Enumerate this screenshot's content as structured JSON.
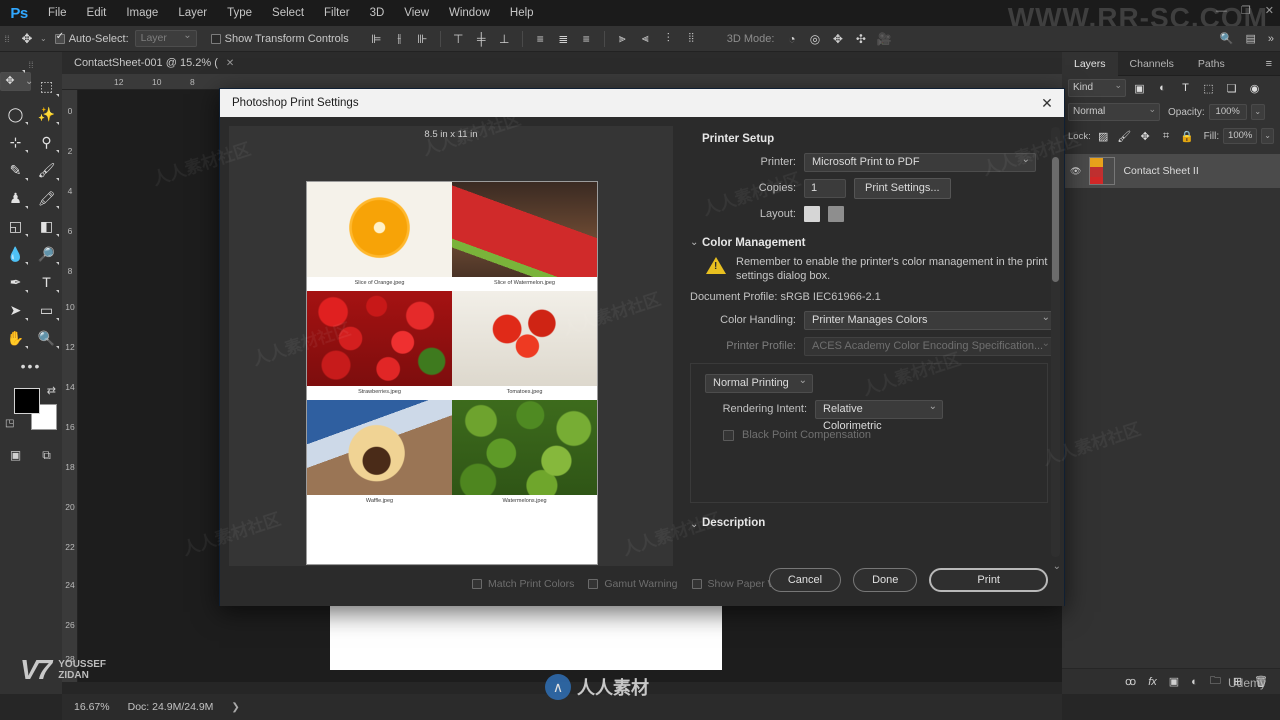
{
  "app": {
    "logo": "Ps",
    "menus": [
      "File",
      "Edit",
      "Image",
      "Layer",
      "Type",
      "Select",
      "Filter",
      "3D",
      "View",
      "Window",
      "Help"
    ],
    "watermark_top": "WWW.RR-SC.COM",
    "watermark_center": "人人素材",
    "watermark_brand_v7": "V7",
    "watermark_brand_line1": "YOUSSEF",
    "watermark_brand_line2": "ZIDAN",
    "watermark_udemy": "Udemy",
    "win_minimize": "—",
    "win_restore": "❐",
    "win_close": "✕"
  },
  "options_bar": {
    "tool_icon": "move-tool",
    "auto_select_label": "Auto-Select:",
    "auto_select_checked": true,
    "layer_select_value": "Layer",
    "show_transform_label": "Show Transform Controls",
    "show_transform_checked": false,
    "align_icons": [
      "align-left-edges",
      "align-horizontal-centers",
      "align-right-edges",
      "align-top-edges",
      "align-vertical-centers",
      "align-bottom-edges"
    ],
    "distribute_icons": [
      "distribute-top-edges",
      "distribute-vertical-centers",
      "distribute-bottom-edges",
      "distribute-left-edges",
      "distribute-horizontal-centers",
      "distribute-right-edges",
      "distribute-spacing"
    ],
    "three_d_label": "3D Mode:",
    "three_d_icons": [
      "orbit-3d",
      "roll-3d",
      "pan-3d",
      "slide-3d",
      "camera-3d"
    ],
    "search_icon": "search-icon",
    "arrange_icon": "arrange-documents-icon"
  },
  "toolbox": {
    "tools": [
      "move-tool",
      "rectangular-marquee-tool",
      "lasso-tool",
      "magic-wand-tool",
      "crop-tool",
      "eyedropper-tool",
      "healing-brush-tool",
      "brush-tool",
      "clone-stamp-tool",
      "history-brush-tool",
      "eraser-tool",
      "gradient-tool",
      "blur-tool",
      "dodge-tool",
      "pen-tool",
      "type-tool",
      "path-selection-tool",
      "rectangle-tool",
      "hand-tool",
      "zoom-tool"
    ],
    "more_tools": "•••",
    "foreground_color": "#000000",
    "background_color": "#ffffff",
    "swap_colors_icon": "swap-colors-icon",
    "default_colors_icon": "default-colors-icon",
    "quick_mask_icon": "quick-mask-icon",
    "screen_mode_icon": "screen-mode-icon"
  },
  "document": {
    "tab_title": "ContactSheet-001 @ 15.2% (",
    "tab_close": "✕",
    "ruler_h_ticks": [
      "12",
      "10",
      "8"
    ],
    "ruler_v_ticks": [
      "0",
      "2",
      "4",
      "6",
      "8",
      "10",
      "12",
      "14",
      "16",
      "18",
      "20",
      "22",
      "24",
      "26",
      "28"
    ]
  },
  "status_bar": {
    "zoom": "16.67%",
    "doc_info": "Doc: 24.9M/24.9M",
    "expand_arrow": "❯"
  },
  "layers_panel": {
    "tabs": [
      "Layers",
      "Channels",
      "Paths"
    ],
    "active_tab": "Layers",
    "menu_icon": "panel-menu-icon",
    "blend_mode": "Normal",
    "opacity_label": "Opacity:",
    "opacity_value": "100%",
    "fill_label": "Fill:",
    "fill_value": "100%",
    "filter_icons": [
      "filter-image-icon",
      "filter-adjustment-icon",
      "filter-type-icon",
      "filter-shape-icon",
      "filter-smart-object-icon",
      "filter-toggle-icon"
    ],
    "lock_icons": [
      "lock-transparent-icon",
      "lock-image-icon",
      "lock-position-icon",
      "lock-artboard-icon",
      "lock-all-icon"
    ],
    "layer_name": "Contact Sheet II",
    "footer_icons": [
      "link-layers-icon",
      "layer-style-icon",
      "layer-mask-icon",
      "adjustment-layer-icon",
      "new-group-icon",
      "new-layer-icon",
      "delete-layer-icon"
    ]
  },
  "dialog": {
    "title": "Photoshop Print Settings",
    "close_icon": "close-icon",
    "paper_size_label": "8.5 in x 11 in",
    "printer_setup": {
      "section_title": "Printer Setup",
      "twirl": "⌄",
      "printer_label": "Printer:",
      "printer_value": "Microsoft Print to PDF",
      "copies_label": "Copies:",
      "copies_value": "1",
      "print_settings_button": "Print Settings...",
      "layout_label": "Layout:",
      "layout_portrait_icon": "layout-portrait-icon",
      "layout_landscape_icon": "layout-landscape-icon"
    },
    "color_management": {
      "section_title": "Color Management",
      "twirl": "⌄",
      "warning_icon": "warning-triangle-icon",
      "warning_text": "Remember to enable the printer's color management in the print settings dialog box.",
      "document_profile_label": "Document Profile:",
      "document_profile_value": "sRGB IEC61966-2.1",
      "color_handling_label": "Color Handling:",
      "color_handling_value": "Printer Manages Colors",
      "printer_profile_label": "Printer Profile:",
      "printer_profile_value": "ACES Academy Color Encoding Specification...",
      "printing_mode_value": "Normal Printing",
      "rendering_intent_label": "Rendering Intent:",
      "rendering_intent_value": "Relative Colorimetric",
      "black_point_label": "Black Point Compensation",
      "black_point_checked": false
    },
    "description": {
      "section_title": "Description",
      "twirl": "⌄"
    },
    "bottom_checks": [
      {
        "label": "Match Print Colors",
        "checked": false
      },
      {
        "label": "Gamut Warning",
        "checked": false
      },
      {
        "label": "Show Paper White",
        "checked": false
      }
    ],
    "buttons": {
      "cancel": "Cancel",
      "done": "Done",
      "print": "Print"
    }
  },
  "contact_sheet": {
    "cells": [
      {
        "caption": "Slice of Orange.jpeg",
        "kind": "orange"
      },
      {
        "caption": "Slice of Watermelon.jpeg",
        "kind": "watermelon"
      },
      {
        "caption": "Strawberries.jpeg",
        "kind": "strawberries"
      },
      {
        "caption": "Tomatoes.jpeg",
        "kind": "tomatoes"
      },
      {
        "caption": "Waffle.jpeg",
        "kind": "waffle"
      },
      {
        "caption": "Watermelons.jpeg",
        "kind": "watermelons"
      }
    ]
  }
}
